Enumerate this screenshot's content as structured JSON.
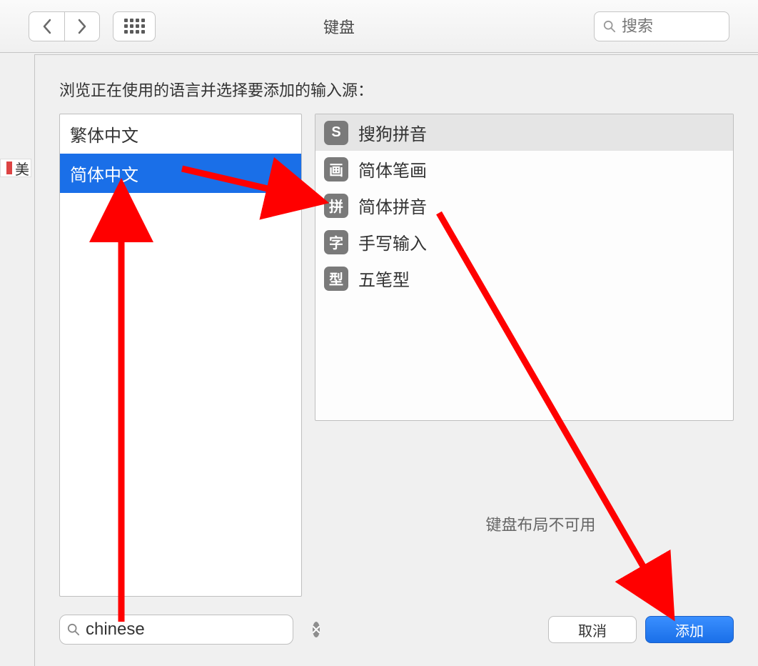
{
  "toolbar": {
    "title": "键盘",
    "search_placeholder": "搜索"
  },
  "sidebar_cut_label": "美",
  "sheet": {
    "instruction": "浏览正在使用的语言并选择要添加的输入源：",
    "languages": [
      {
        "label": "繁体中文",
        "selected": false
      },
      {
        "label": "简体中文",
        "selected": true
      }
    ],
    "sources": [
      {
        "icon": "S",
        "label": "搜狗拼音"
      },
      {
        "icon": "画",
        "label": "简体笔画"
      },
      {
        "icon": "拼",
        "label": "简体拼音"
      },
      {
        "icon": "字",
        "label": "手写输入"
      },
      {
        "icon": "型",
        "label": "五笔型"
      }
    ],
    "status_message": "键盘布局不可用",
    "search_value": "chinese",
    "cancel_label": "取消",
    "add_label": "添加"
  }
}
